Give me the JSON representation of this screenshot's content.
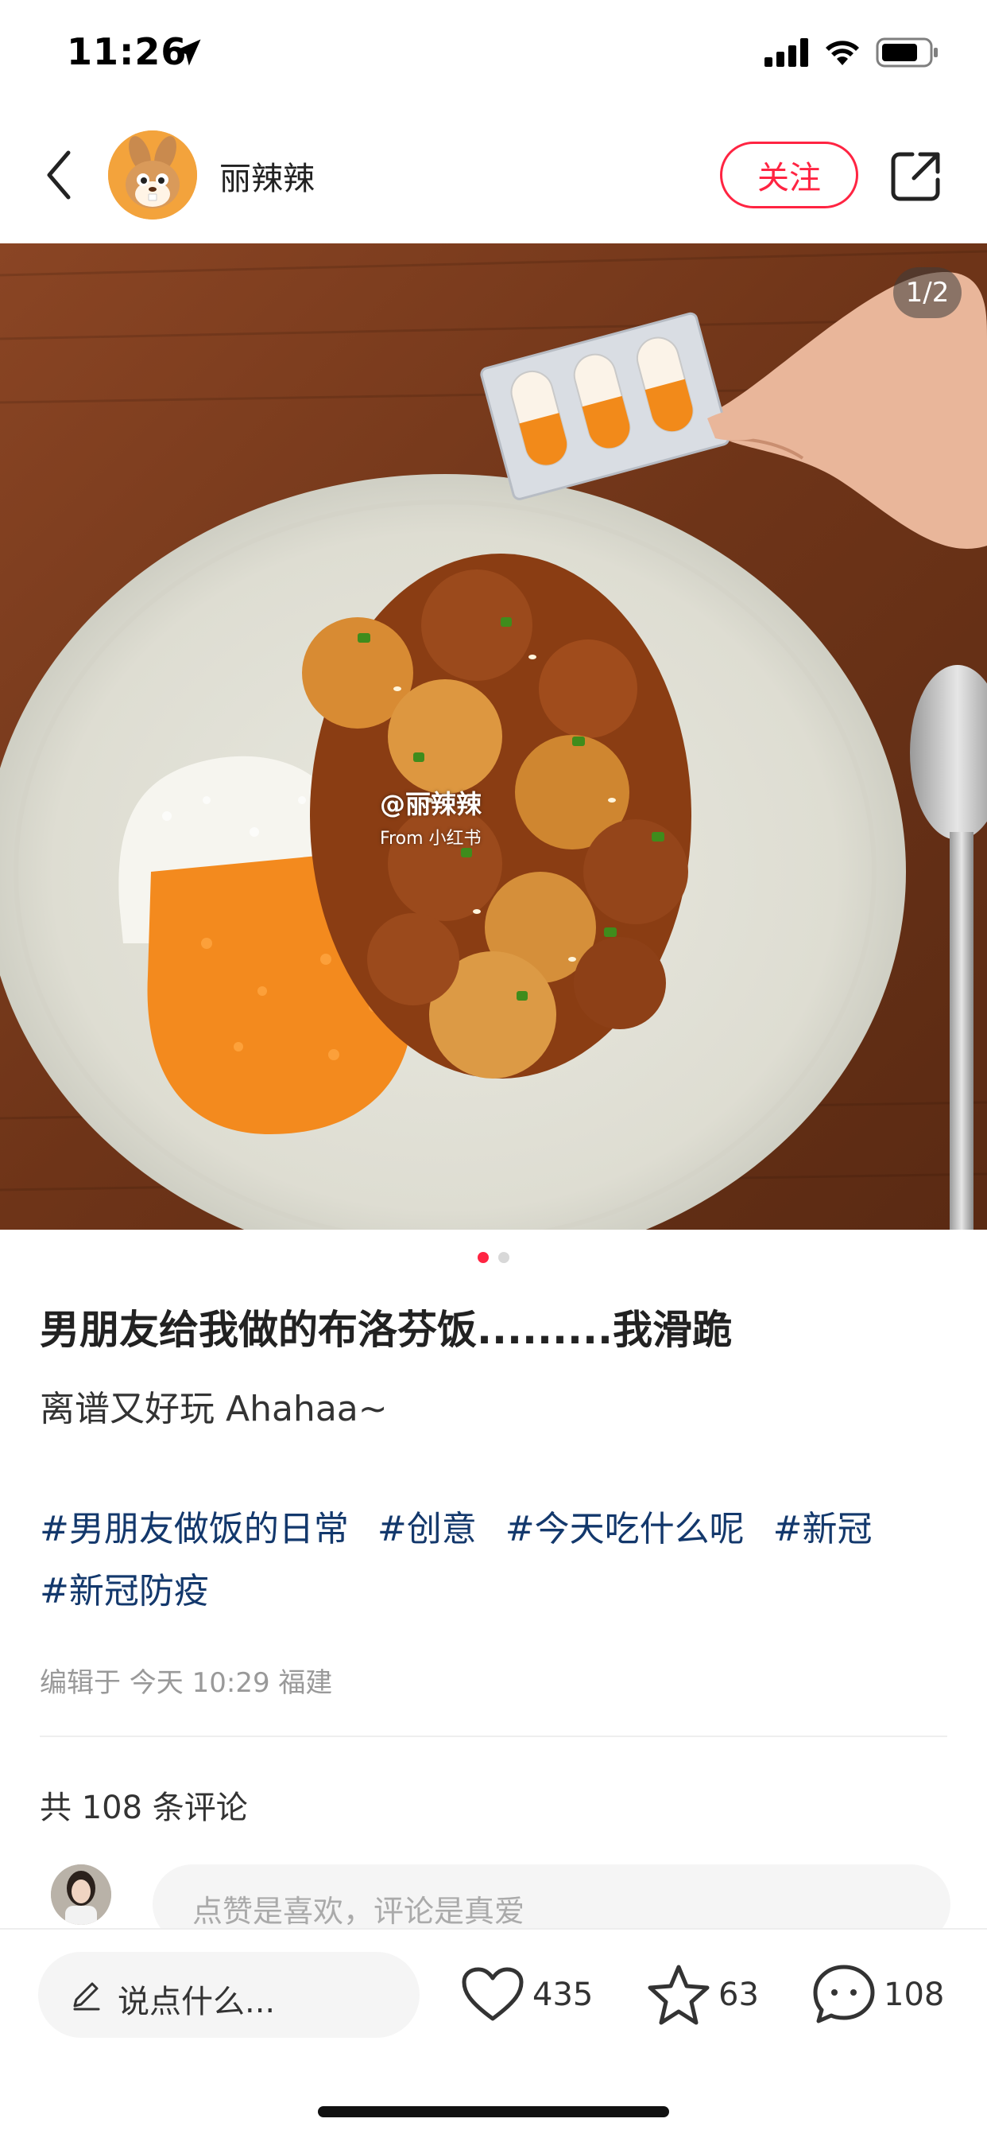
{
  "status_bar": {
    "time": "11:26",
    "icons": [
      "location-arrow-icon",
      "cellular-signal-icon",
      "wifi-icon",
      "battery-icon"
    ]
  },
  "header": {
    "back_icon": "chevron-left-icon",
    "author_name": "丽辣辣",
    "follow_label": "关注",
    "share_icon": "share-icon"
  },
  "media": {
    "page_counter": "1/2",
    "watermark_name": "@丽辣辣",
    "watermark_from": "From 小红书",
    "total_pages": 2,
    "current_page": 1
  },
  "post": {
    "title": "男朋友给我做的布洛芬饭.........我滑跪",
    "description": "离谱又好玩 Ahahaa~",
    "tags": [
      "#男朋友做饭的日常",
      "#创意",
      "#今天吃什么呢",
      "#新冠",
      "#新冠防疫"
    ],
    "meta": "编辑于 今天 10:29 福建"
  },
  "comments": {
    "count_label": "共 108 条评论",
    "input_placeholder": "点赞是喜欢，评论是真爱"
  },
  "bottom_bar": {
    "say_placeholder": "说点什么...",
    "likes": "435",
    "favorites": "63",
    "comments": "108"
  },
  "colors": {
    "accent": "#ff2442",
    "tag": "#13386c",
    "muted": "#999999"
  }
}
